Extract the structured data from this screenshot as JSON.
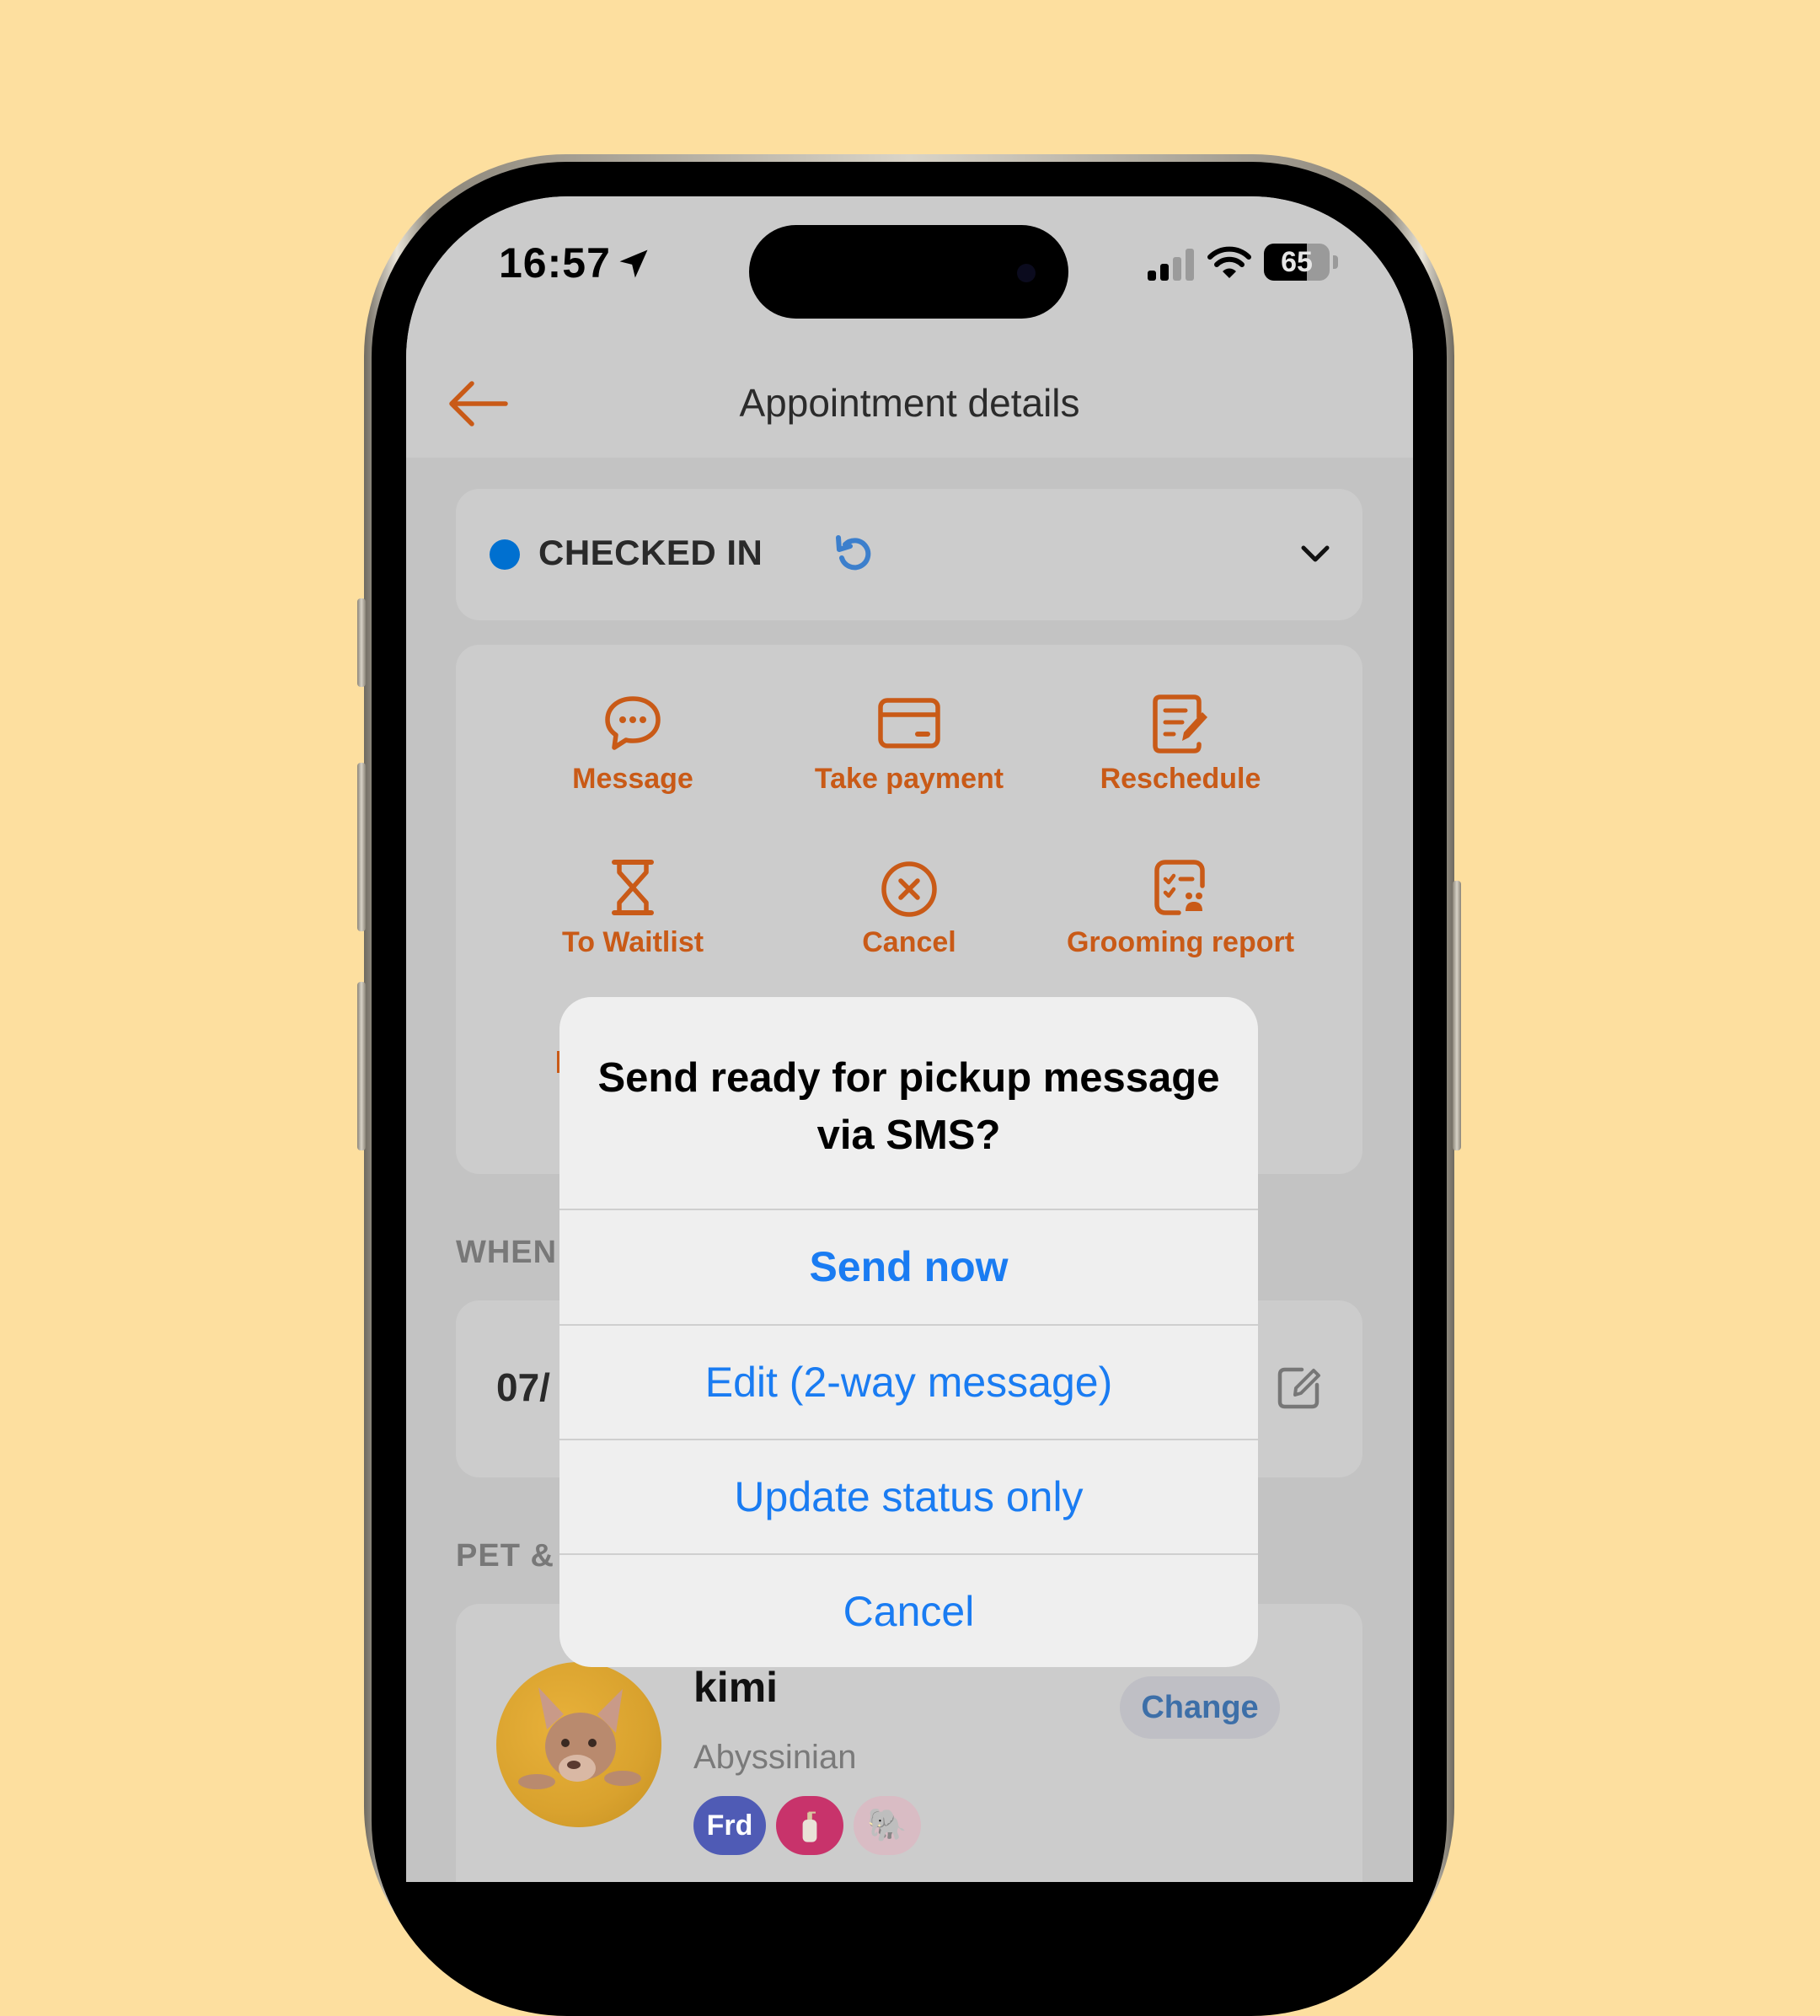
{
  "status_bar": {
    "time": "16:57",
    "battery_percent": "65",
    "battery_level": 0.65,
    "signal_bars_active": 2,
    "signal_bars_total": 4
  },
  "nav": {
    "title": "Appointment details"
  },
  "appointment_status": {
    "label": "CHECKED IN",
    "dot_color": "#0070d0"
  },
  "actions": [
    {
      "label": "Message",
      "icon": "chat-bubble-icon"
    },
    {
      "label": "Take payment",
      "icon": "credit-card-icon"
    },
    {
      "label": "Reschedule",
      "icon": "edit-note-icon"
    },
    {
      "label": "To Waitlist",
      "icon": "hourglass-icon"
    },
    {
      "label": "Cancel",
      "icon": "cancel-circle-icon"
    },
    {
      "label": "Grooming report",
      "icon": "grooming-report-icon"
    }
  ],
  "accent_color": "#c95a17",
  "sections": {
    "when_label": "WHEN",
    "pet_label": "PET &"
  },
  "date": {
    "value": "07/"
  },
  "pet": {
    "name": "kimi",
    "breed": "Abyssinian",
    "change_label": "Change",
    "tags": [
      {
        "label": "Frd",
        "color": "#4f5bb5"
      },
      {
        "label": "",
        "icon": "lotion-bottle-icon",
        "color": "#c8336b"
      },
      {
        "label": "🐘",
        "icon": "elephant-icon",
        "color": "#d9bcc4"
      }
    ]
  },
  "dialog": {
    "title": "Send ready for pickup message via SMS?",
    "buttons": [
      {
        "label": "Send now",
        "primary": true
      },
      {
        "label": "Edit (2-way message)",
        "primary": false
      },
      {
        "label": "Update status only",
        "primary": false
      },
      {
        "label": "Cancel",
        "primary": false
      }
    ],
    "button_color": "#1a7cf2"
  }
}
